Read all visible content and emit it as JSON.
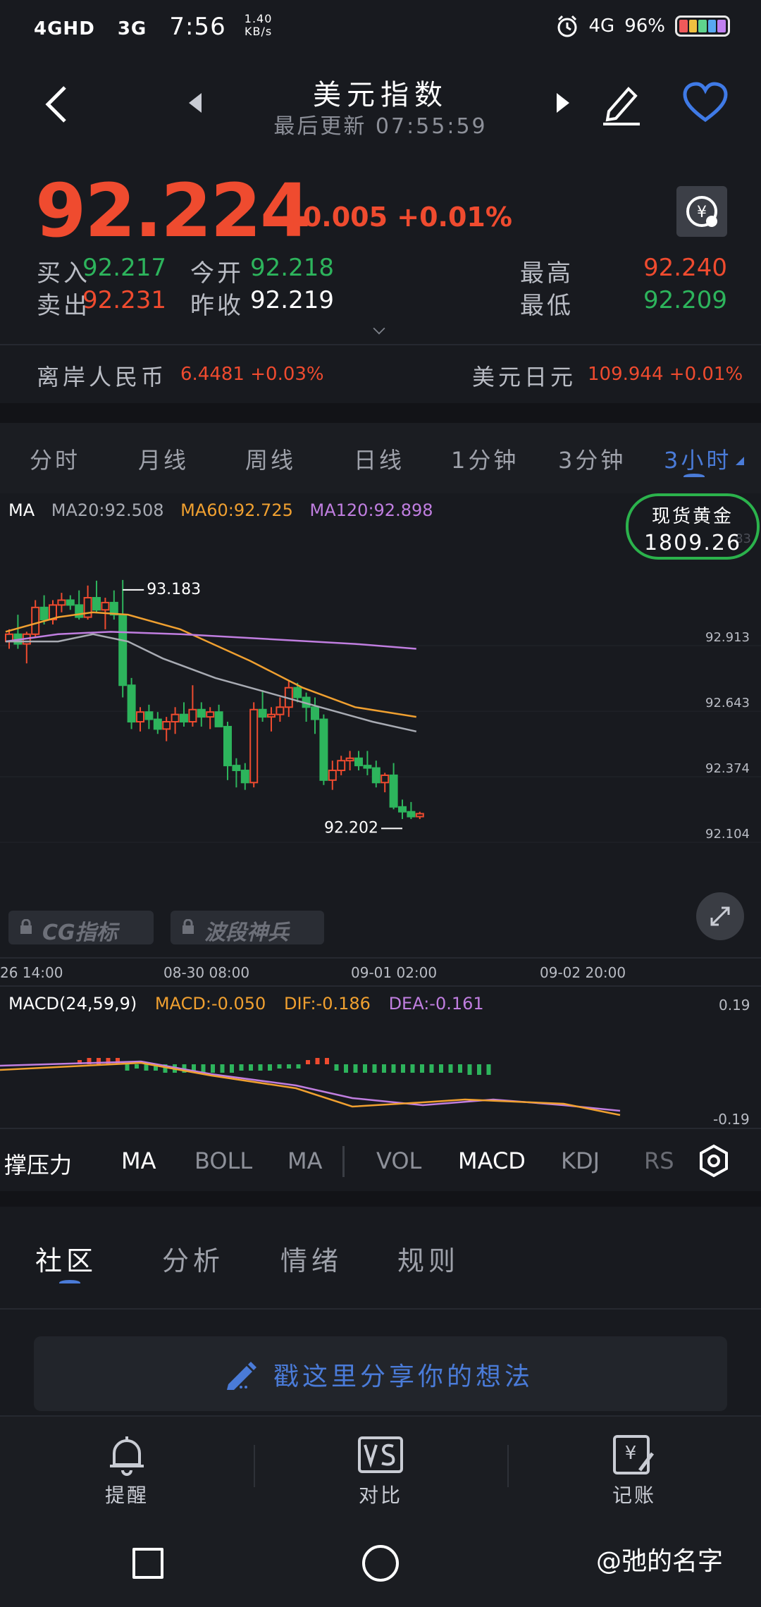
{
  "status_bar": {
    "network1": "4GHD",
    "network2": "3G",
    "time": "7:56",
    "speed_value": "1.40",
    "speed_unit": "KB/s",
    "network_right": "4G",
    "battery": "96%"
  },
  "header": {
    "title": "美元指数",
    "subtitle": "最后更新  07:55:59"
  },
  "quote": {
    "price": "92.224",
    "change": "+0.005 +0.01%",
    "rows": [
      {
        "l1": "买入",
        "v1": "92.217",
        "l2": "今开",
        "v2": "92.218",
        "l3": "最高",
        "v3": "92.240"
      },
      {
        "l1": "卖出",
        "v1": "92.231",
        "l2": "昨收",
        "v2": "92.219",
        "l3": "最低",
        "v3": "92.209"
      }
    ]
  },
  "related": {
    "item1_label": "离岸人民币",
    "item1_value": "6.4481 +0.03%",
    "item2_label": "美元日元",
    "item2_value": "109.944 +0.01%"
  },
  "timeframe_tabs": [
    "分时",
    "月线",
    "周线",
    "日线",
    "1分钟",
    "3分钟",
    "3小时"
  ],
  "chart": {
    "ma_legend": {
      "label": "MA",
      "ma20": "MA20:92.508",
      "ma60": "MA60:92.725",
      "ma120": "MA120:92.898"
    },
    "high_marker": "93.183",
    "low_marker": "92.202",
    "gold_label": "现货黄金",
    "gold_value": "1809.26",
    "y_tick_top_partial": "83",
    "y_ticks": [
      "92.913",
      "92.643",
      "92.374",
      "92.104"
    ],
    "x_ticks": [
      "26 14:00",
      "08-30 08:00",
      "09-01 02:00",
      "09-02 20:00"
    ],
    "badge1": "CG指标",
    "badge2": "波段神兵",
    "colors": {
      "up": "#ef4b2f",
      "down": "#2db45c",
      "ma20": "#a8abb3",
      "ma60": "#f0a030",
      "ma120": "#c07ee0"
    }
  },
  "chart_data": {
    "type": "candlestick",
    "series": [
      {
        "name": "MA20",
        "value": 92.508
      },
      {
        "name": "MA60",
        "value": 92.725
      },
      {
        "name": "MA120",
        "value": 92.898
      }
    ],
    "marked_high": 93.183,
    "marked_low": 92.202,
    "y_ticks": [
      92.913,
      92.643,
      92.374,
      92.104
    ]
  },
  "macd": {
    "label": "MACD(24,59,9)",
    "macd": "MACD:-0.050",
    "dif": "DIF:-0.186",
    "dea": "DEA:-0.161",
    "y_top": "0.19",
    "y_bottom": "-0.19"
  },
  "indicators": [
    "撑压力",
    "MA",
    "BOLL",
    "MA",
    "VOL",
    "MACD",
    "KDJ",
    "RS"
  ],
  "community_tabs": [
    "社区",
    "分析",
    "情绪",
    "规则"
  ],
  "share_placeholder": "戳这里分享你的想法",
  "bottom_nav": [
    "提醒",
    "对比",
    "记账"
  ],
  "watermark": "@弛的名字"
}
